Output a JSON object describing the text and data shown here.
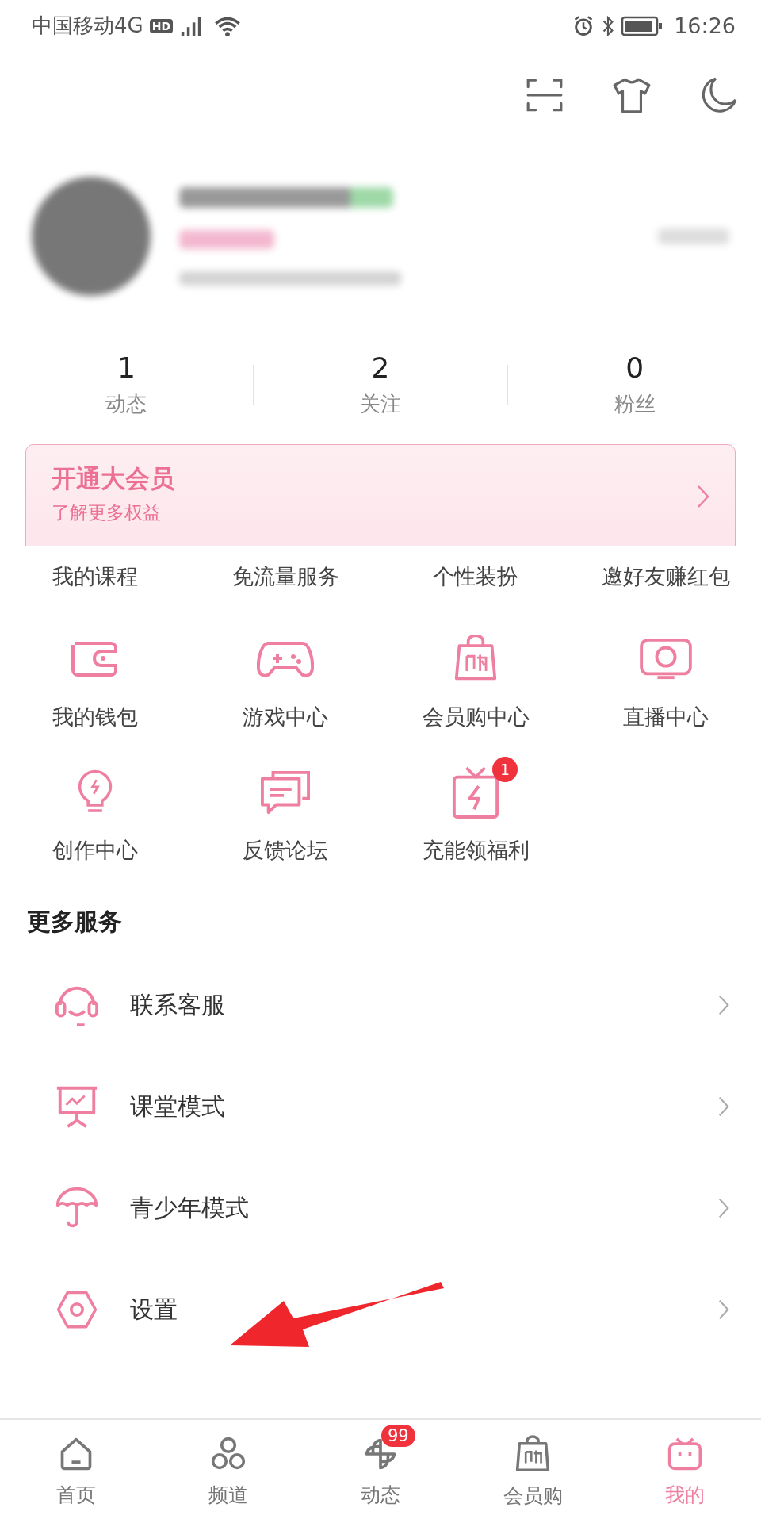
{
  "status_bar": {
    "carrier": "中国移动4G",
    "network_badge": "HD",
    "time": "16:26"
  },
  "stats": [
    {
      "value": "1",
      "label": "动态"
    },
    {
      "value": "2",
      "label": "关注"
    },
    {
      "value": "0",
      "label": "粉丝"
    }
  ],
  "vip_banner": {
    "title": "开通大会员",
    "subtitle": "了解更多权益"
  },
  "services": [
    {
      "label": "我的课程"
    },
    {
      "label": "免流量服务"
    },
    {
      "label": "个性装扮"
    },
    {
      "label": "邀好友赚红包"
    },
    {
      "label": "我的钱包"
    },
    {
      "label": "游戏中心"
    },
    {
      "label": "会员购中心"
    },
    {
      "label": "直播中心"
    },
    {
      "label": "创作中心"
    },
    {
      "label": "反馈论坛"
    },
    {
      "label": "充能领福利",
      "badge": "1"
    }
  ],
  "more_services": {
    "title": "更多服务",
    "items": [
      {
        "label": "联系客服"
      },
      {
        "label": "课堂模式"
      },
      {
        "label": "青少年模式"
      },
      {
        "label": "设置"
      }
    ]
  },
  "nav": [
    {
      "label": "首页",
      "selected": false
    },
    {
      "label": "频道",
      "selected": false
    },
    {
      "label": "动态",
      "selected": false,
      "badge": "99"
    },
    {
      "label": "会员购",
      "selected": false
    },
    {
      "label": "我的",
      "selected": true
    }
  ]
}
